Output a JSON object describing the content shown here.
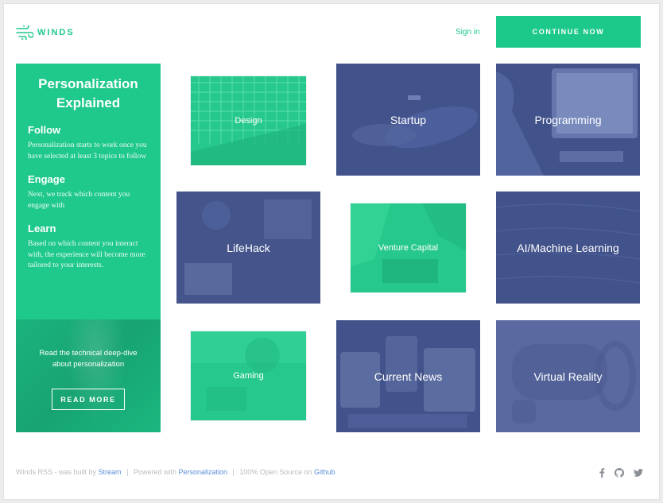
{
  "header": {
    "logo_text": "WINDS",
    "sign_in": "Sign in",
    "continue": "CONTINUE NOW"
  },
  "sidebar": {
    "title_line1": "Personalization",
    "title_line2": "Explained",
    "sections": [
      {
        "heading": "Follow",
        "body": "Personalization starts to work once you have selected at least 3 topics to follow"
      },
      {
        "heading": "Engage",
        "body": "Next, we track which content you engage with"
      },
      {
        "heading": "Learn",
        "body": "Based on which content you interact with, the experience will become more tailored to your interests."
      }
    ],
    "deep_dive_line1": "Read the technical deep-dive",
    "deep_dive_line2": "about personalization",
    "read_more": "READ MORE"
  },
  "topics": [
    {
      "label": "Design"
    },
    {
      "label": "Startup"
    },
    {
      "label": "Programming"
    },
    {
      "label": "LifeHack"
    },
    {
      "label": "Venture Capital"
    },
    {
      "label": "AI/Machine Learning"
    },
    {
      "label": "Gaming"
    },
    {
      "label": "Current News"
    },
    {
      "label": "Virtual Reality"
    }
  ],
  "footer": {
    "prefix": "Winds RSS - was built by",
    "stream_link": "Stream",
    "sep": "|",
    "powered": "Powered with",
    "personalization_link": "Personalization",
    "open_source": "100% Open Source on",
    "github_link": "Github"
  },
  "colors": {
    "brand_green": "#1fc98c",
    "tile_blue": "#42528a",
    "link_blue": "#5a8fd8"
  },
  "icons": [
    "winds-logo-icon",
    "facebook-icon",
    "github-icon",
    "twitter-icon"
  ]
}
